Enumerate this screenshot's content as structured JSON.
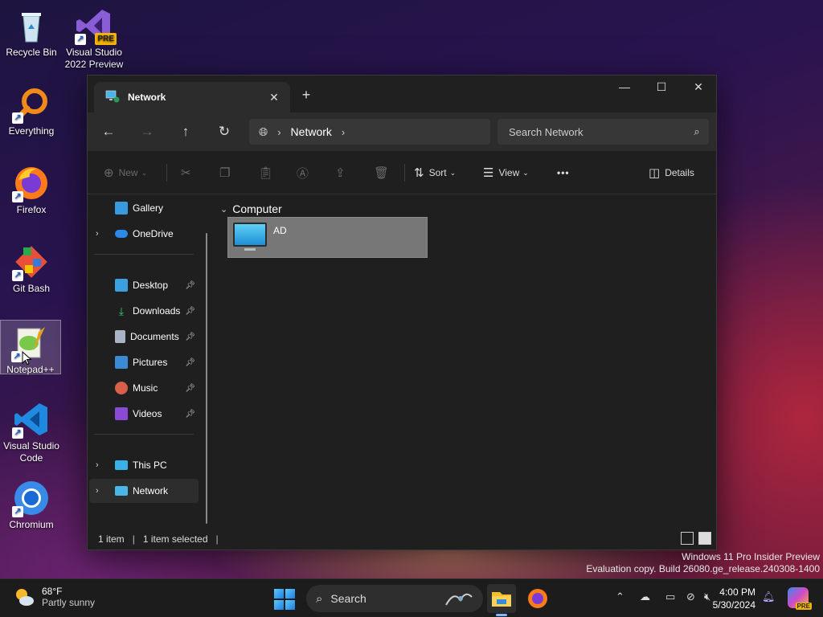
{
  "desktop": {
    "icons": [
      {
        "label": "Recycle Bin"
      },
      {
        "label": "Visual Studio 2022 Preview",
        "badge": "PRE"
      },
      {
        "label": "Everything"
      },
      {
        "label": "Firefox"
      },
      {
        "label": "Git Bash"
      },
      {
        "label": "Notepad++"
      },
      {
        "label": "Visual Studio Code"
      },
      {
        "label": "Chromium"
      }
    ]
  },
  "window": {
    "tab_title": "Network",
    "nav": {
      "address_crumb": "Network",
      "search_placeholder": "Search Network"
    },
    "toolbar": {
      "new_label": "New",
      "sort_label": "Sort",
      "view_label": "View",
      "more_label": "•••",
      "details_label": "Details"
    },
    "sidebar": {
      "items": [
        {
          "label": "Gallery"
        },
        {
          "label": "OneDrive"
        },
        {
          "label": "Desktop"
        },
        {
          "label": "Downloads"
        },
        {
          "label": "Documents"
        },
        {
          "label": "Pictures"
        },
        {
          "label": "Music"
        },
        {
          "label": "Videos"
        },
        {
          "label": "This PC"
        },
        {
          "label": "Network"
        }
      ]
    },
    "content": {
      "group_header": "Computer",
      "items": [
        {
          "label": "AD"
        }
      ]
    },
    "status": {
      "count": "1 item",
      "selected": "1 item selected"
    }
  },
  "watermark": {
    "line1": "Windows 11 Pro Insider Preview",
    "line2": "Evaluation copy. Build 26080.ge_release.240308-1400"
  },
  "taskbar": {
    "weather_temp": "68°F",
    "weather_cond": "Partly sunny",
    "search_label": "Search",
    "time": "4:00 PM",
    "date": "5/30/2024",
    "copilot_badge": "PRE"
  }
}
